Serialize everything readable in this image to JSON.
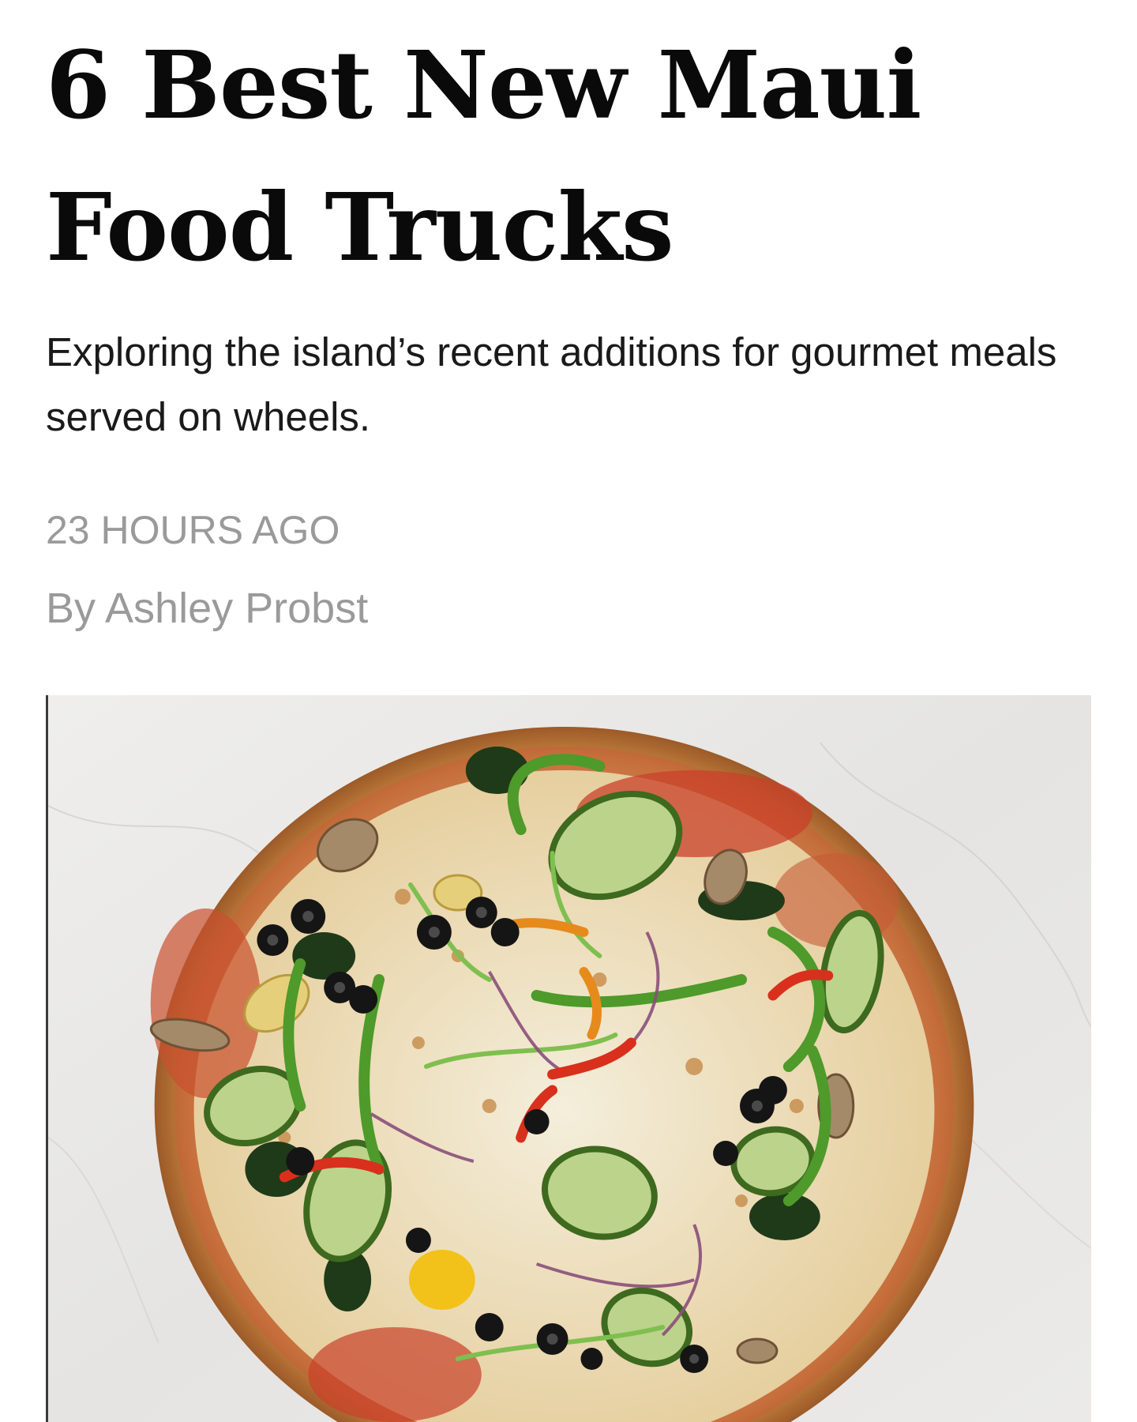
{
  "article": {
    "headline_line1": "6 Best New Maui",
    "headline_line2": "Food Trucks",
    "dek": "Exploring the island’s recent additions for gourmet meals served on wheels.",
    "timestamp": "23 HOURS AGO",
    "byline": "By Ashley Probst"
  },
  "hero_image": {
    "subject": "pizza-photo",
    "colors": {
      "marble": "#e9e8e6",
      "crust": "#c98a4d",
      "sauce": "#c9402a",
      "cheese": "#f0ead2",
      "zucchini": "#6f9a3e",
      "olive": "#151515",
      "pepper_red": "#d8301c",
      "pepper_yellow": "#f2c21b",
      "pepper_green": "#4e9a2a",
      "spinach": "#1f3a18",
      "onion": "#8a4f7a",
      "mushroom": "#a58a6a"
    }
  }
}
